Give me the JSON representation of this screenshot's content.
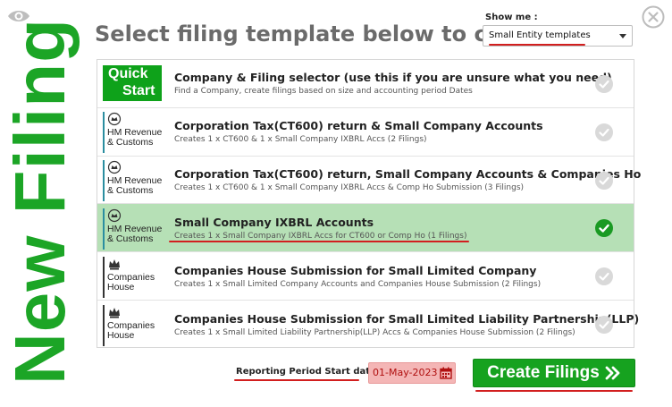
{
  "header": {
    "side_title": "New Filing",
    "title": "Select filing template below to create",
    "show_me_label": "Show me :",
    "show_me_value": "Small Entity templates"
  },
  "templates": [
    {
      "logo": "quick-start",
      "logo_text": [
        "Quick",
        "Start"
      ],
      "title": "Company & Filing selector (use this if you are unsure what you need)",
      "subtitle": "Find a Company, create filings based on size and accounting period Dates",
      "selected": false
    },
    {
      "logo": "hmrc",
      "logo_text": [
        "HM Revenue",
        "& Customs"
      ],
      "title": "Corporation Tax(CT600) return & Small Company Accounts",
      "subtitle": "Creates 1 x CT600 & 1 x Small Company IXBRL Accs (2 Filings)",
      "selected": false
    },
    {
      "logo": "hmrc",
      "logo_text": [
        "HM Revenue",
        "& Customs"
      ],
      "title": "Corporation Tax(CT600) return, Small Company Accounts & Companies Ho",
      "subtitle": "Creates 1 x CT600 & 1 x Small Company IXBRL Accs & Comp Ho Submission (3 Filings)",
      "selected": false
    },
    {
      "logo": "hmrc",
      "logo_text": [
        "HM Revenue",
        "& Customs"
      ],
      "title": "Small Company IXBRL Accounts",
      "subtitle": "Creates 1 x Small Company IXBRL Accs for CT600 or Comp Ho (1 Filings)",
      "selected": true
    },
    {
      "logo": "companies-house",
      "logo_text": [
        "Companies",
        "House"
      ],
      "title": "Companies House Submission for Small Limited Company",
      "subtitle": "Creates 1 x Small Limited Company Accounts and Companies House Submission (2 Filings)",
      "selected": false
    },
    {
      "logo": "companies-house",
      "logo_text": [
        "Companies",
        "House"
      ],
      "title": "Companies House Submission for Small Limited Liability Partnership(LLP)",
      "subtitle": "Creates 1 x Small Limited Liability Partnership(LLP) Accs & Companies House Submission (2 Filings)",
      "selected": false
    }
  ],
  "footer": {
    "period_label": "Reporting Period Start date :",
    "period_value": "01-May-2023",
    "create_label": "Create Filings"
  },
  "icons": {
    "eye": "eye-icon",
    "close": "close-icon",
    "check": "check-circle-icon",
    "calendar": "calendar-icon",
    "chevrons": "double-chevron-right-icon"
  },
  "colors": {
    "brand_green": "#16a21f",
    "selected_row": "#b6e0b6",
    "date_field": "#f4b6b6",
    "highlight_red": "#d21f1f"
  }
}
